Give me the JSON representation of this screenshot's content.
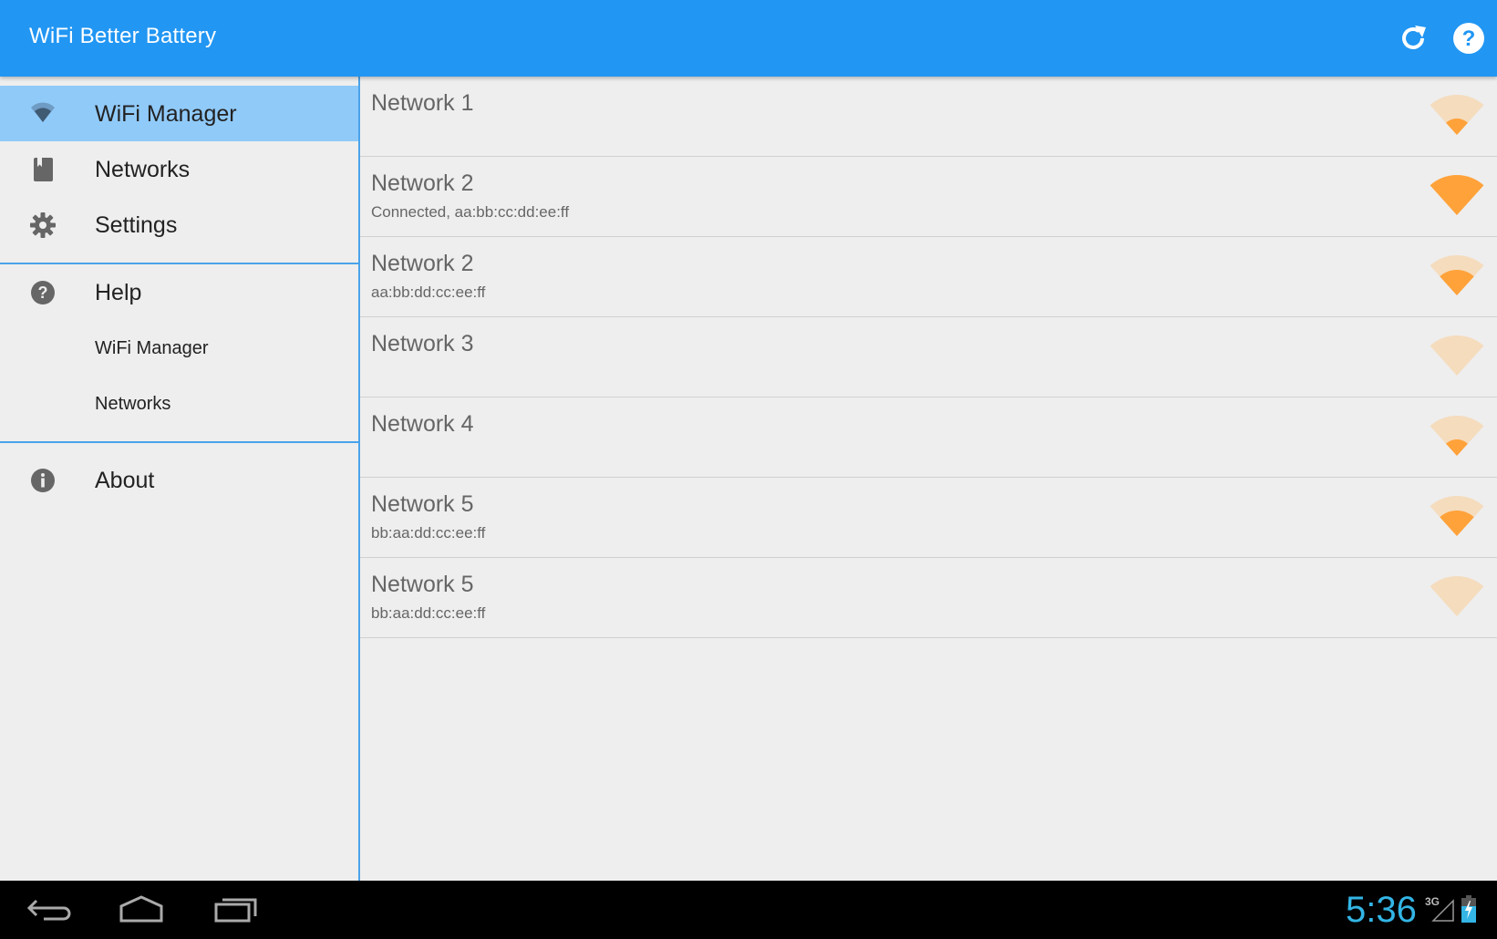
{
  "action_bar": {
    "title": "WiFi Better Battery",
    "color": "#2196f3",
    "actions": [
      {
        "name": "refresh",
        "icon": "refresh-icon"
      },
      {
        "name": "help",
        "icon": "help-icon"
      }
    ]
  },
  "drawer": {
    "items": [
      {
        "label": "WiFi Manager",
        "icon": "wifi-icon",
        "selected": true
      },
      {
        "label": "Networks",
        "icon": "bookmark-book-icon",
        "selected": false
      },
      {
        "label": "Settings",
        "icon": "gear-icon",
        "selected": false
      }
    ],
    "help_section": {
      "label": "Help",
      "icon": "help-circle-icon",
      "subitems": [
        {
          "label": "WiFi Manager"
        },
        {
          "label": "Networks"
        }
      ]
    },
    "about": {
      "label": "About",
      "icon": "info-icon"
    },
    "selected_color": "#90caf9"
  },
  "networks": [
    {
      "name": "Network 1",
      "detail": "",
      "signal_level": 1,
      "signal_max": 4
    },
    {
      "name": "Network 2",
      "detail": "Connected, aa:bb:cc:dd:ee:ff",
      "signal_level": 4,
      "signal_max": 4
    },
    {
      "name": "Network 2",
      "detail": "aa:bb:dd:cc:ee:ff",
      "signal_level": 2,
      "signal_max": 4
    },
    {
      "name": "Network 3",
      "detail": "",
      "signal_level": 0,
      "signal_max": 4
    },
    {
      "name": "Network 4",
      "detail": "",
      "signal_level": 1,
      "signal_max": 4
    },
    {
      "name": "Network 5",
      "detail": "bb:aa:dd:cc:ee:ff",
      "signal_level": 2,
      "signal_max": 4
    },
    {
      "name": "Network 5",
      "detail": "bb:aa:dd:cc:ee:ff",
      "signal_level": 0,
      "signal_max": 4
    }
  ],
  "signal_colors": {
    "active": "#ffa23a",
    "inactive": "#f5dcbd"
  },
  "system_bar": {
    "clock": "5:36",
    "network_type": "3G",
    "clock_color": "#33b5e5",
    "buttons": [
      "back",
      "home",
      "recent-apps"
    ]
  }
}
